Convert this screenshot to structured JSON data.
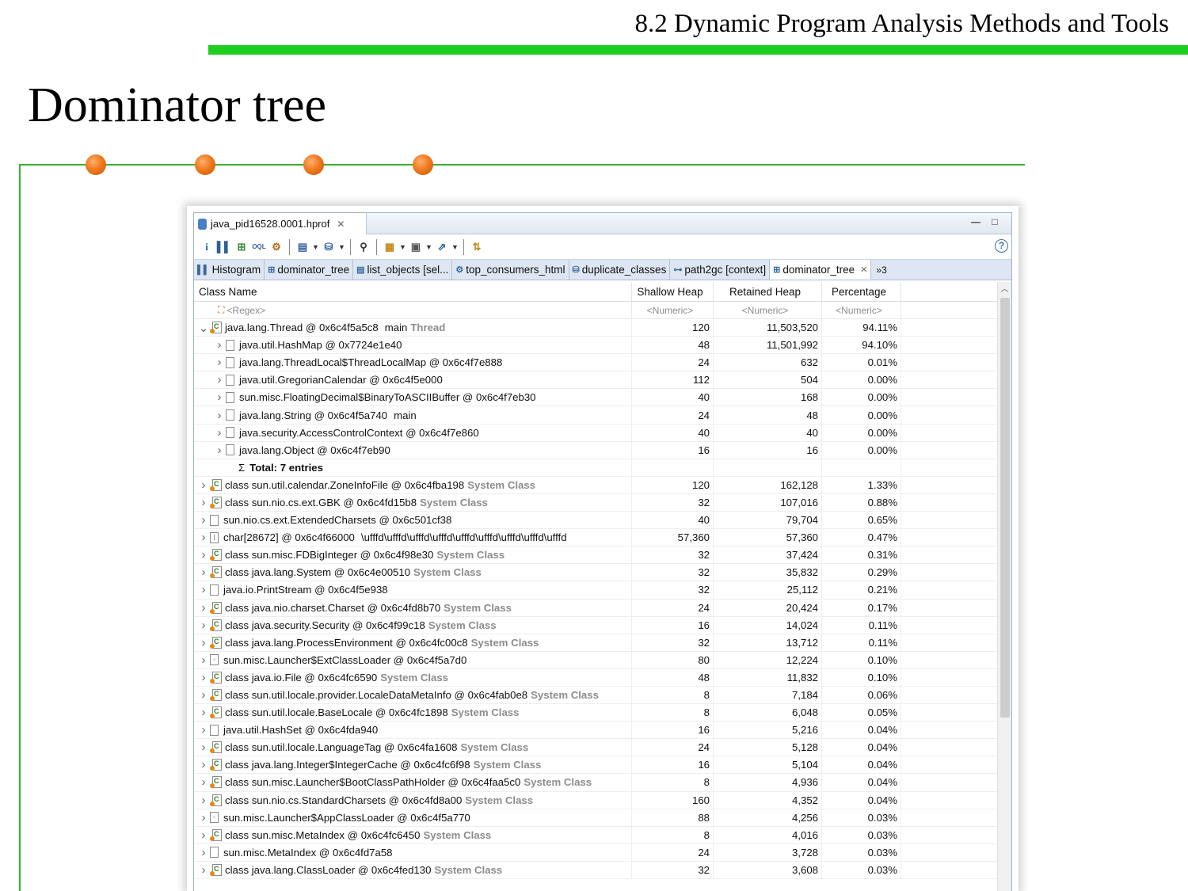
{
  "slide": {
    "header": "8.2 Dynamic Program Analysis Methods and Tools",
    "title": "Dominator tree"
  },
  "window": {
    "editor_tab": "java_pid16528.0001.hprof",
    "minimize": "▭",
    "maximize": "□",
    "help": "?"
  },
  "view_tabs": [
    {
      "label": "Histogram",
      "icon": "histogram-icon"
    },
    {
      "label": "dominator_tree",
      "icon": "tree-icon"
    },
    {
      "label": "list_objects [sel...",
      "icon": "list-icon"
    },
    {
      "label": "top_consumers_html",
      "icon": "consumers-icon"
    },
    {
      "label": "duplicate_classes",
      "icon": "duplicate-icon"
    },
    {
      "label": "path2gc [context]",
      "icon": "path-icon"
    },
    {
      "label": "dominator_tree",
      "icon": "tree-icon",
      "active": true
    }
  ],
  "tab_overflow": "»3",
  "columns": {
    "name": "Class Name",
    "shallow": "Shallow Heap",
    "retained": "Retained Heap",
    "pct": "Percentage"
  },
  "filters": {
    "name": "<Regex>",
    "shallow": "<Numeric>",
    "retained": "<Numeric>",
    "pct": "<Numeric>"
  },
  "root": {
    "name": "java.lang.Thread @ 0x6c4f5a5c8",
    "extra": "main",
    "sys": "Thread",
    "shallow": "120",
    "retained": "11,503,520",
    "pct": "94.11%"
  },
  "children": [
    {
      "name": "java.util.HashMap @ 0x7724e1e40",
      "shallow": "48",
      "retained": "11,501,992",
      "pct": "94.10%"
    },
    {
      "name": "java.lang.ThreadLocal$ThreadLocalMap @ 0x6c4f7e888",
      "shallow": "24",
      "retained": "632",
      "pct": "0.01%"
    },
    {
      "name": "java.util.GregorianCalendar @ 0x6c4f5e000",
      "shallow": "112",
      "retained": "504",
      "pct": "0.00%"
    },
    {
      "name": "sun.misc.FloatingDecimal$BinaryToASCIIBuffer @ 0x6c4f7eb30",
      "shallow": "40",
      "retained": "168",
      "pct": "0.00%"
    },
    {
      "name": "java.lang.String @ 0x6c4f5a740",
      "extra": "main",
      "shallow": "24",
      "retained": "48",
      "pct": "0.00%"
    },
    {
      "name": "java.security.AccessControlContext @ 0x6c4f7e860",
      "shallow": "40",
      "retained": "40",
      "pct": "0.00%"
    },
    {
      "name": "java.lang.Object @ 0x6c4f7eb90",
      "shallow": "16",
      "retained": "16",
      "pct": "0.00%"
    }
  ],
  "total": "Total: 7 entries",
  "rows": [
    {
      "kind": "class",
      "name": "class sun.util.calendar.ZoneInfoFile @ 0x6c4fba198",
      "sys": "System Class",
      "shallow": "120",
      "retained": "162,128",
      "pct": "1.33%"
    },
    {
      "kind": "class",
      "name": "class sun.nio.cs.ext.GBK @ 0x6c4fd15b8",
      "sys": "System Class",
      "shallow": "32",
      "retained": "107,016",
      "pct": "0.88%"
    },
    {
      "kind": "obj",
      "name": "sun.nio.cs.ext.ExtendedCharsets @ 0x6c501cf38",
      "sys": "",
      "shallow": "40",
      "retained": "79,704",
      "pct": "0.65%"
    },
    {
      "kind": "arr",
      "name": "char[28672] @ 0x6c4f66000",
      "sys": "",
      "extra": "\\ufffd\\ufffd\\ufffd\\ufffd\\ufffd\\ufffd\\ufffd\\ufffd\\ufffd",
      "shallow": "57,360",
      "retained": "57,360",
      "pct": "0.47%"
    },
    {
      "kind": "class",
      "name": "class sun.misc.FDBigInteger @ 0x6c4f98e30",
      "sys": "System Class",
      "shallow": "32",
      "retained": "37,424",
      "pct": "0.31%"
    },
    {
      "kind": "class",
      "name": "class java.lang.System @ 0x6c4e00510",
      "sys": "System Class",
      "shallow": "32",
      "retained": "35,832",
      "pct": "0.29%"
    },
    {
      "kind": "obj",
      "name": "java.io.PrintStream @ 0x6c4f5e938",
      "sys": "",
      "shallow": "32",
      "retained": "25,112",
      "pct": "0.21%"
    },
    {
      "kind": "class",
      "name": "class java.nio.charset.Charset @ 0x6c4fd8b70",
      "sys": "System Class",
      "shallow": "24",
      "retained": "20,424",
      "pct": "0.17%"
    },
    {
      "kind": "class",
      "name": "class java.security.Security @ 0x6c4f99c18",
      "sys": "System Class",
      "shallow": "16",
      "retained": "14,024",
      "pct": "0.11%"
    },
    {
      "kind": "class",
      "name": "class java.lang.ProcessEnvironment @ 0x6c4fc00c8",
      "sys": "System Class",
      "shallow": "32",
      "retained": "13,712",
      "pct": "0.11%"
    },
    {
      "kind": "loader",
      "name": "sun.misc.Launcher$ExtClassLoader @ 0x6c4f5a7d0",
      "sys": "",
      "shallow": "80",
      "retained": "12,224",
      "pct": "0.10%"
    },
    {
      "kind": "class",
      "name": "class java.io.File @ 0x6c4fc6590",
      "sys": "System Class",
      "shallow": "48",
      "retained": "11,832",
      "pct": "0.10%"
    },
    {
      "kind": "class",
      "name": "class sun.util.locale.provider.LocaleDataMetaInfo @ 0x6c4fab0e8",
      "sys": "System Class",
      "shallow": "8",
      "retained": "7,184",
      "pct": "0.06%"
    },
    {
      "kind": "class",
      "name": "class sun.util.locale.BaseLocale @ 0x6c4fc1898",
      "sys": "System Class",
      "shallow": "8",
      "retained": "6,048",
      "pct": "0.05%"
    },
    {
      "kind": "obj",
      "name": "java.util.HashSet @ 0x6c4fda940",
      "sys": "",
      "shallow": "16",
      "retained": "5,216",
      "pct": "0.04%"
    },
    {
      "kind": "class",
      "name": "class sun.util.locale.LanguageTag @ 0x6c4fa1608",
      "sys": "System Class",
      "shallow": "24",
      "retained": "5,128",
      "pct": "0.04%"
    },
    {
      "kind": "class",
      "name": "class java.lang.Integer$IntegerCache @ 0x6c4fc6f98",
      "sys": "System Class",
      "shallow": "16",
      "retained": "5,104",
      "pct": "0.04%"
    },
    {
      "kind": "class",
      "name": "class sun.misc.Launcher$BootClassPathHolder @ 0x6c4faa5c0",
      "sys": "System Class",
      "shallow": "8",
      "retained": "4,936",
      "pct": "0.04%"
    },
    {
      "kind": "class",
      "name": "class sun.nio.cs.StandardCharsets @ 0x6c4fd8a00",
      "sys": "System Class",
      "shallow": "160",
      "retained": "4,352",
      "pct": "0.04%"
    },
    {
      "kind": "loader",
      "name": "sun.misc.Launcher$AppClassLoader @ 0x6c4f5a770",
      "sys": "",
      "shallow": "88",
      "retained": "4,256",
      "pct": "0.03%"
    },
    {
      "kind": "class",
      "name": "class sun.misc.MetaIndex @ 0x6c4fc6450",
      "sys": "System Class",
      "shallow": "8",
      "retained": "4,016",
      "pct": "0.03%"
    },
    {
      "kind": "obj",
      "name": "sun.misc.MetaIndex @ 0x6c4fd7a58",
      "sys": "",
      "shallow": "24",
      "retained": "3,728",
      "pct": "0.03%"
    },
    {
      "kind": "class",
      "name": "class java.lang.ClassLoader @ 0x6c4fed130",
      "sys": "System Class",
      "shallow": "32",
      "retained": "3,608",
      "pct": "0.03%"
    }
  ]
}
